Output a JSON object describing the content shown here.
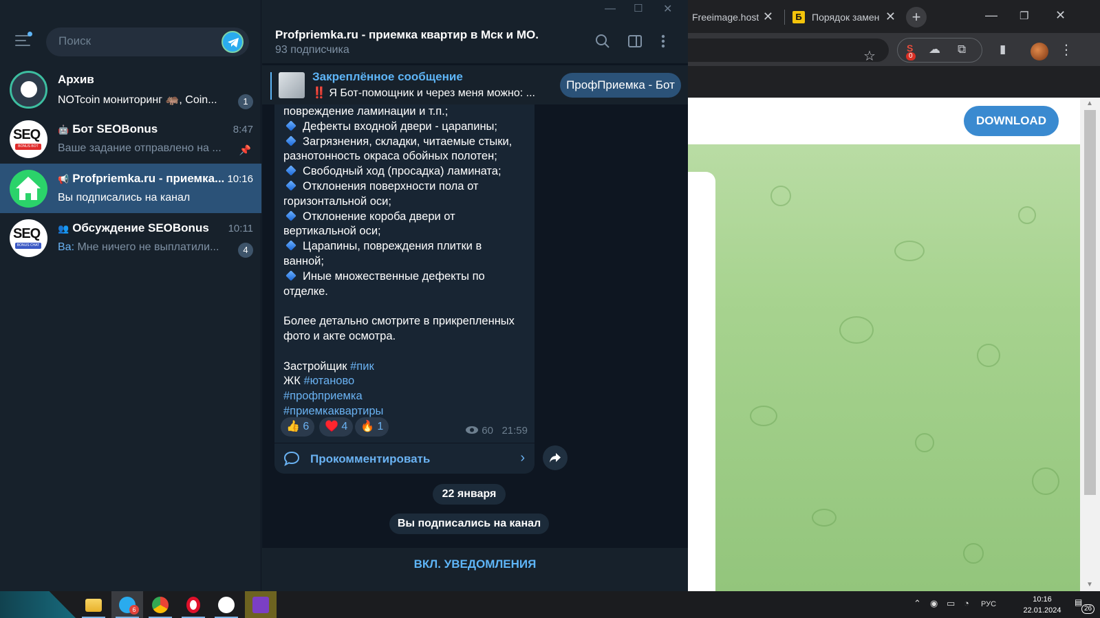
{
  "chrome": {
    "tabs": [
      {
        "title": "Freeimage.host"
      },
      {
        "title": "Порядок замен",
        "favicon": "Б"
      }
    ],
    "extension_badge": "0",
    "download_label": "DOWNLOAD"
  },
  "sidebar": {
    "search_placeholder": "Поиск",
    "chats": [
      {
        "name": "Архив",
        "preview": "NOTcoin мониторинг 🦛, Coin...",
        "badge": "1"
      },
      {
        "name": "Бот SEOBonus",
        "time": "8:47",
        "preview": "Ваше задание отправлено на ..."
      },
      {
        "name": "Profpriemka.ru - приемка...",
        "time": "10:16",
        "preview": "Вы подписались на канал"
      },
      {
        "name": "Обсуждение SEOBonus",
        "time": "10:11",
        "preview_sender": "Ва:",
        "preview": "Мне ничего не выплатили...",
        "badge": "4"
      }
    ],
    "avatar_texts": {
      "seo": "SEQ",
      "seo_bot_ribbon": "BONUS BOT",
      "seo_chat_ribbon": "BONUS CHAT"
    }
  },
  "channel": {
    "title": "Profpriemka.ru - приемка квартир в Мск и МО.",
    "subscribers": "93 подписчика",
    "pinned": {
      "title": "Закреплённое сообщение",
      "text": "‼️ Я Бот-помощник и через меня можно: ...",
      "button": "ПрофПриемка - Бот"
    },
    "message": {
      "lines": [
        {
          "text": "повреждение ламинации и т.п.;"
        },
        {
          "text": "Дефекты входной двери - царапины;",
          "bullet": true
        },
        {
          "text": "Загрязнения, складки, читаемые стыки,",
          "bullet": true
        },
        {
          "text": "разнотонность окраса обойных полотен;"
        },
        {
          "text": "Свободный ход (просадка) ламината;",
          "bullet": true
        },
        {
          "text": "Отклонения поверхности пола от",
          "bullet": true
        },
        {
          "text": "горизонтальной оси;"
        },
        {
          "text": "Отклонение короба двери от",
          "bullet": true
        },
        {
          "text": "вертикальной оси;"
        },
        {
          "text": "Царапины, повреждения плитки в",
          "bullet": true
        },
        {
          "text": "ванной;"
        },
        {
          "text": "Иные множественные дефекты по",
          "bullet": true
        },
        {
          "text": "отделке."
        },
        {
          "text": ""
        },
        {
          "text": "Более детально смотрите в прикрепленных"
        },
        {
          "text": "фото и акте осмотра."
        },
        {
          "text": ""
        }
      ],
      "developer_label": "Застройщик",
      "developer_tag": "#пик",
      "complex_label": "ЖК",
      "complex_tag": "#ютаново",
      "tag3": "#профприемка",
      "tag4": "#приемкаквартиры",
      "reactions": [
        {
          "emoji": "👍",
          "count": "6"
        },
        {
          "emoji": "♥️",
          "count": "4"
        },
        {
          "emoji": "🔥",
          "count": "1"
        }
      ],
      "views": "60",
      "time": "21:59",
      "comment_label": "Прокомментировать"
    },
    "date_pill": "22 января",
    "service_message": "Вы подписались на канал",
    "bottom_button": "ВКЛ. УВЕДОМЛЕНИЯ"
  },
  "taskbar": {
    "telegram_badge": "6",
    "language": "РУС",
    "time": "10:16",
    "date": "22.01.2024",
    "notifications": "26"
  }
}
